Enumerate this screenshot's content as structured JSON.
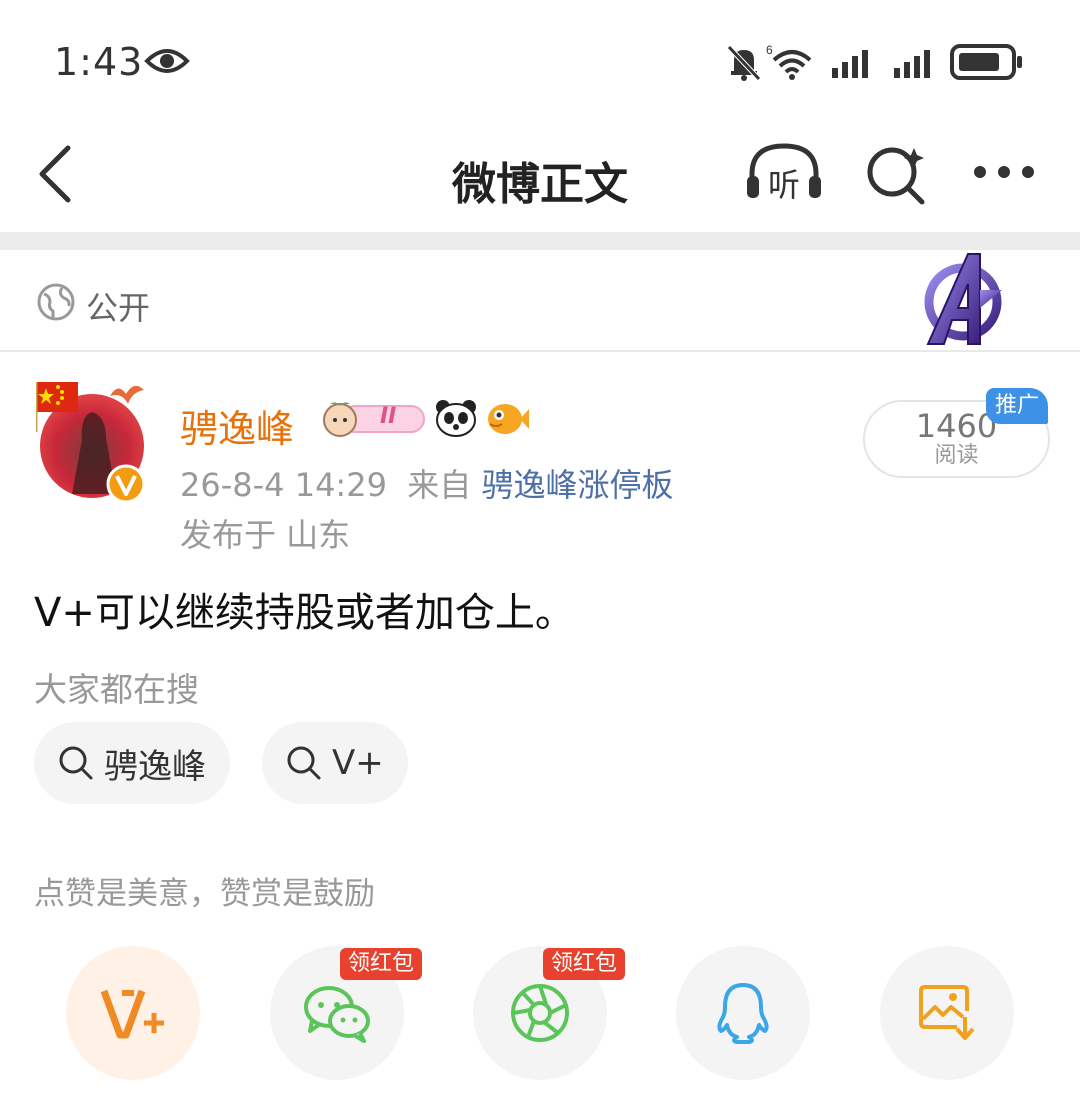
{
  "status_bar": {
    "time": "1:43"
  },
  "nav": {
    "title": "微博正文",
    "listen_label": "听"
  },
  "visibility": {
    "label": "公开"
  },
  "post": {
    "author": "骋逸峰",
    "badge_level": "II",
    "date": "26-8-4 14:29",
    "from_prefix": "来自",
    "source": "骋逸峰涨停板",
    "location": "发布于 山东",
    "content": "V+可以继续持股或者加仓上。",
    "read_count": "1460",
    "read_label": "阅读",
    "promo_badge": "推广"
  },
  "search": {
    "heading": "大家都在搜",
    "chips": [
      "骋逸峰",
      "V+"
    ]
  },
  "like_tip": "点赞是美意，赞赏是鼓励",
  "share": {
    "red_packet_label": "领红包",
    "items": [
      "vplus-icon",
      "wechat-icon",
      "moments-icon",
      "qq-icon",
      "save-image-icon"
    ]
  },
  "colors": {
    "username": "#e8710a",
    "source_link": "#4e6fa8",
    "promo_badge": "#3d92e8",
    "red_tag": "#e8412d"
  }
}
